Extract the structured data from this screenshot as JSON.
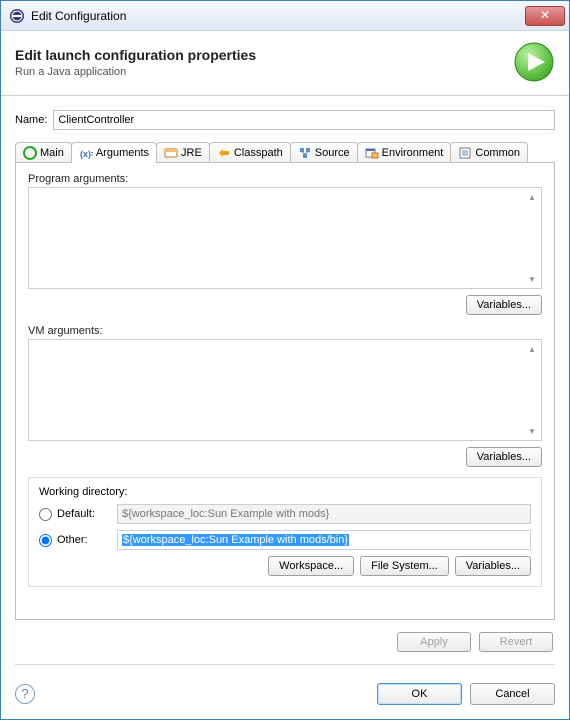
{
  "window": {
    "title": "Edit Configuration"
  },
  "header": {
    "title": "Edit launch configuration properties",
    "subtitle": "Run a Java application"
  },
  "name": {
    "label": "Name:",
    "value": "ClientController"
  },
  "tabs": {
    "main": "Main",
    "arguments": "Arguments",
    "jre": "JRE",
    "classpath": "Classpath",
    "source": "Source",
    "environment": "Environment",
    "common": "Common"
  },
  "program_args": {
    "label": "Program arguments:",
    "value": "",
    "variables_btn": "Variables..."
  },
  "vm_args": {
    "label": "VM arguments:",
    "value": "",
    "variables_btn": "Variables..."
  },
  "working_dir": {
    "title": "Working directory:",
    "default_label": "Default:",
    "default_value": "${workspace_loc:Sun Example with mods}",
    "other_label": "Other:",
    "other_value": "${workspace_loc:Sun Example with mods/bin}",
    "workspace_btn": "Workspace...",
    "filesystem_btn": "File System...",
    "variables_btn": "Variables..."
  },
  "actions": {
    "apply": "Apply",
    "revert": "Revert",
    "ok": "OK",
    "cancel": "Cancel"
  },
  "colors": {
    "selection": "#3399ff",
    "primary_border": "#4a90d9"
  }
}
